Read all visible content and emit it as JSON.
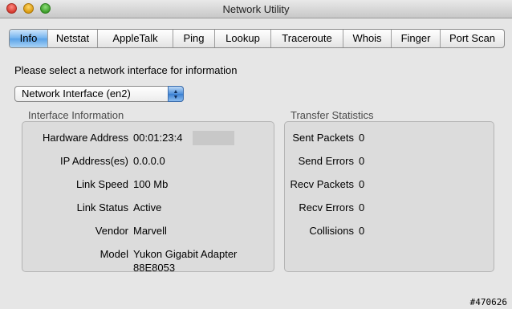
{
  "window": {
    "title": "Network Utility"
  },
  "tabs": [
    {
      "label": "Info",
      "active": true
    },
    {
      "label": "Netstat",
      "active": false
    },
    {
      "label": "AppleTalk",
      "active": false
    },
    {
      "label": "Ping",
      "active": false
    },
    {
      "label": "Lookup",
      "active": false
    },
    {
      "label": "Traceroute",
      "active": false
    },
    {
      "label": "Whois",
      "active": false
    },
    {
      "label": "Finger",
      "active": false
    },
    {
      "label": "Port Scan",
      "active": false
    }
  ],
  "info": {
    "prompt": "Please select a network interface for information",
    "interface_selected": "Network Interface (en2)",
    "interface_group_title": "Interface Information",
    "transfer_group_title": "Transfer Statistics",
    "interface_rows": [
      {
        "label": "Hardware Address",
        "value": "00:01:23:4"
      },
      {
        "label": "IP Address(es)",
        "value": "0.0.0.0"
      },
      {
        "label": "Link Speed",
        "value": "100 Mb"
      },
      {
        "label": "Link Status",
        "value": "Active"
      },
      {
        "label": "Vendor",
        "value": "Marvell"
      },
      {
        "label": "Model",
        "value": "Yukon Gigabit Adapter",
        "value2": "88E8053"
      }
    ],
    "transfer_rows": [
      {
        "label": "Sent Packets",
        "value": "0"
      },
      {
        "label": "Send Errors",
        "value": "0"
      },
      {
        "label": "Recv Packets",
        "value": "0"
      },
      {
        "label": "Recv Errors",
        "value": "0"
      },
      {
        "label": "Collisions",
        "value": "0"
      }
    ]
  },
  "footer": {
    "watermark": "#470626"
  },
  "colors": {
    "selected_tab": "#6fb1ee",
    "window_bg": "#e6e6e6"
  }
}
